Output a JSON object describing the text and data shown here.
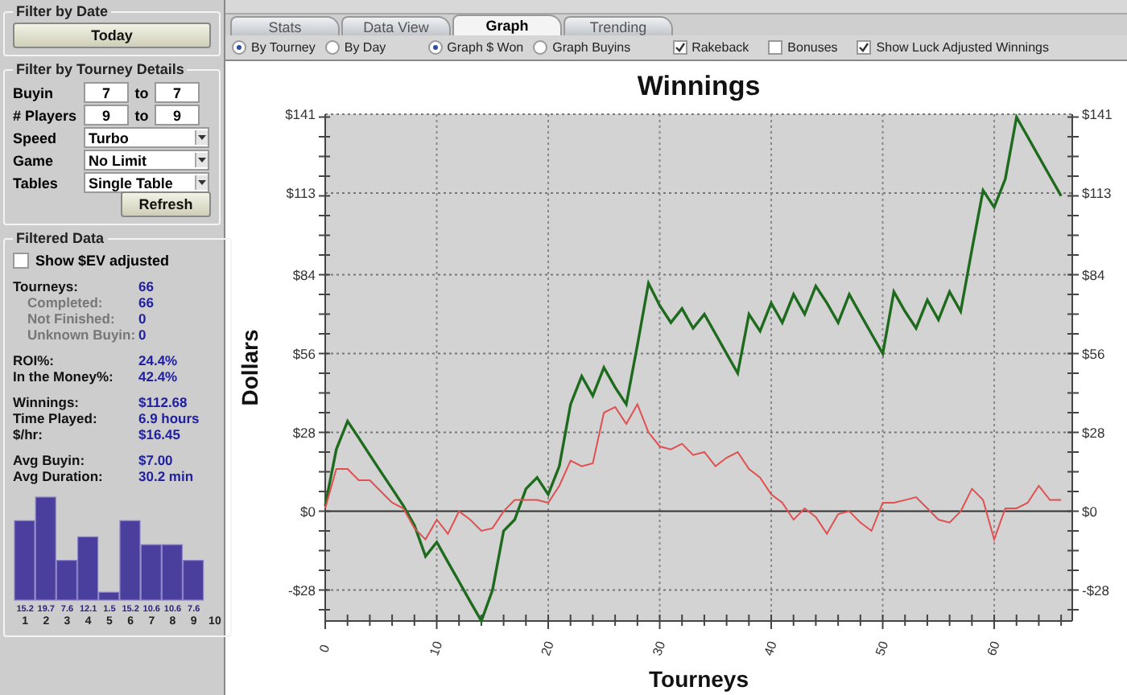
{
  "sidebar": {
    "date_filter": {
      "title": "Filter by Date",
      "button": "Today"
    },
    "tourney_filter": {
      "title": "Filter by Tourney Details",
      "ranges": [
        {
          "label": "Buyin",
          "from": "7",
          "sep": "to",
          "to": "7"
        },
        {
          "label": "# Players",
          "from": "9",
          "sep": "to",
          "to": "9"
        }
      ],
      "selects": [
        {
          "label": "Speed",
          "value": "Turbo"
        },
        {
          "label": "Game",
          "value": "No Limit"
        },
        {
          "label": "Tables",
          "value": "Single Table"
        }
      ],
      "button": "Refresh"
    },
    "filtered_data": {
      "title": "Filtered Data",
      "ev_checkbox": {
        "label": "Show $EV adjusted",
        "checked": false
      },
      "stat_groups": [
        [
          {
            "kind": "main",
            "label": "Tourneys:",
            "value": "66"
          },
          {
            "kind": "sub",
            "label": "Completed:",
            "value": "66"
          },
          {
            "kind": "sub",
            "label": "Not Finished:",
            "value": "0"
          },
          {
            "kind": "sub",
            "label": "Unknown Buyin:",
            "value": "0"
          }
        ],
        [
          {
            "kind": "main",
            "label": "ROI%:",
            "value": "24.4%"
          },
          {
            "kind": "main",
            "label": "In the Money%:",
            "value": "42.4%"
          }
        ],
        [
          {
            "kind": "main",
            "label": "Winnings:",
            "value": "$112.68"
          },
          {
            "kind": "main",
            "label": "Time Played:",
            "value": "6.9 hours"
          },
          {
            "kind": "main",
            "label": "$/hr:",
            "value": "$16.45"
          }
        ],
        [
          {
            "kind": "main",
            "label": "Avg Buyin:",
            "value": "$7.00"
          },
          {
            "kind": "main",
            "label": "Avg Duration:",
            "value": "30.2 min"
          }
        ]
      ],
      "chart_data": {
        "type": "bar",
        "categories": [
          "1",
          "2",
          "3",
          "4",
          "5",
          "6",
          "7",
          "8",
          "9",
          "10"
        ],
        "series": [
          {
            "color": "#4b3f9e",
            "values": [
              15.2,
              19.7,
              7.6,
              12.1,
              1.5,
              15.2,
              10.6,
              10.6,
              7.6,
              null
            ]
          }
        ],
        "data_labels": true
      }
    }
  },
  "tabs": [
    {
      "label": "Stats",
      "selected": false
    },
    {
      "label": "Data View",
      "selected": false
    },
    {
      "label": "Graph",
      "selected": true
    },
    {
      "label": "Trending",
      "selected": false
    }
  ],
  "options": {
    "radio_groups": [
      [
        {
          "label": "By Tourney",
          "selected": true
        },
        {
          "label": "By Day",
          "selected": false
        }
      ],
      [
        {
          "label": "Graph $ Won",
          "selected": true
        },
        {
          "label": "Graph Buyins",
          "selected": false
        }
      ]
    ],
    "checkboxes": [
      {
        "label": "Rakeback",
        "checked": true
      },
      {
        "label": "Bonuses",
        "checked": false
      },
      {
        "label": "Show Luck Adjusted Winnings",
        "checked": true
      }
    ]
  },
  "graph": {
    "chart_data": {
      "type": "line",
      "title": "Winnings",
      "xlabel": "Tourneys",
      "ylabel": "Dollars",
      "grid": true,
      "x": [
        0,
        1,
        2,
        3,
        4,
        5,
        6,
        7,
        8,
        9,
        10,
        11,
        12,
        13,
        14,
        15,
        16,
        17,
        18,
        19,
        20,
        21,
        22,
        23,
        24,
        25,
        26,
        27,
        28,
        29,
        30,
        31,
        32,
        33,
        34,
        35,
        36,
        37,
        38,
        39,
        40,
        41,
        42,
        43,
        44,
        45,
        46,
        47,
        48,
        49,
        50,
        51,
        52,
        53,
        54,
        55,
        56,
        57,
        58,
        59,
        60,
        61,
        62,
        63,
        64,
        65,
        66
      ],
      "xlim": [
        0,
        67
      ],
      "ylim": [
        -39,
        141
      ],
      "xticks": [
        0,
        10,
        20,
        30,
        40,
        50,
        60
      ],
      "yticks": [
        {
          "value": -28,
          "label": "-$28"
        },
        {
          "value": 0,
          "label": "$0"
        },
        {
          "value": 28,
          "label": "$28"
        },
        {
          "value": 56,
          "label": "$56"
        },
        {
          "value": 84,
          "label": "$84"
        },
        {
          "value": 113,
          "label": "$113"
        },
        {
          "value": 141,
          "label": "$141"
        }
      ],
      "series": [
        {
          "color": "#1e6b1e",
          "values": [
            2,
            22,
            32,
            26,
            20,
            14,
            8,
            2,
            -5,
            -16,
            -11,
            -18,
            -25,
            -32,
            -39,
            -28,
            -7,
            -3,
            8,
            12,
            6,
            16,
            38,
            48,
            41,
            51,
            44,
            38,
            59,
            81,
            73,
            67,
            72,
            65,
            70,
            63,
            56,
            49,
            70,
            64,
            74,
            67,
            77,
            70,
            80,
            74,
            67,
            77,
            70,
            63,
            56,
            78,
            71,
            65,
            75,
            68,
            78,
            71,
            93,
            114,
            108,
            118,
            140,
            133,
            126,
            119,
            112
          ]
        },
        {
          "color": "#e05050",
          "values": [
            1,
            15,
            15,
            11,
            11,
            7,
            3,
            1,
            -6,
            -10,
            -3,
            -8,
            0,
            -3,
            -7,
            -6,
            0,
            4,
            4,
            4,
            3,
            9,
            18,
            16,
            17,
            35,
            37,
            31,
            38,
            28,
            23,
            22,
            24,
            20,
            21,
            16,
            19,
            21,
            15,
            12,
            6,
            3,
            -3,
            1,
            -2,
            -8,
            -1,
            0,
            -4,
            -7,
            3,
            3,
            4,
            5,
            1,
            -3,
            -4,
            0,
            8,
            4,
            -10,
            1,
            1,
            3,
            9,
            4,
            4
          ]
        }
      ]
    }
  }
}
